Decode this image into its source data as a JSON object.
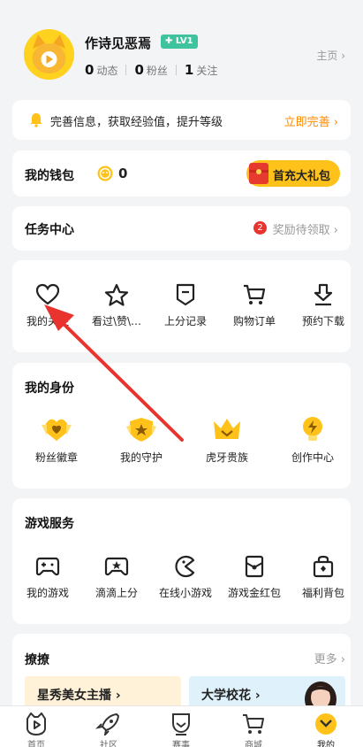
{
  "profile": {
    "username": "作诗见恶焉",
    "level": "✚ LV1",
    "dynamics_count": "0",
    "dynamics_label": "动态",
    "fans_count": "0",
    "fans_label": "粉丝",
    "follow_count": "1",
    "follow_label": "关注",
    "homepage_label": "主页 ›"
  },
  "notice": {
    "text": "完善信息，获取经验值，提升等级",
    "action": "立即完善 ›"
  },
  "wallet": {
    "title": "我的钱包",
    "balance": "0",
    "promo": "首充大礼包"
  },
  "tasks": {
    "title": "任务中心",
    "badge": "2",
    "reward_label": "奖励待领取 ›"
  },
  "quick": {
    "items": [
      {
        "label": "我的关注",
        "icon": "heart-icon"
      },
      {
        "label": "看过\\赞\\…",
        "icon": "star-icon"
      },
      {
        "label": "上分记录",
        "icon": "record-icon"
      },
      {
        "label": "购物订单",
        "icon": "cart-icon"
      },
      {
        "label": "预约下载",
        "icon": "download-icon"
      }
    ]
  },
  "identity": {
    "title": "我的身份",
    "items": [
      {
        "label": "粉丝徽章",
        "icon": "fan-badge-icon"
      },
      {
        "label": "我的守护",
        "icon": "guard-icon"
      },
      {
        "label": "虎牙贵族",
        "icon": "crown-icon"
      },
      {
        "label": "创作中心",
        "icon": "creator-icon"
      }
    ]
  },
  "games": {
    "title": "游戏服务",
    "items": [
      {
        "label": "我的游戏",
        "icon": "gamepad-icon"
      },
      {
        "label": "滴滴上分",
        "icon": "gamepad-star-icon"
      },
      {
        "label": "在线小游戏",
        "icon": "pacman-icon"
      },
      {
        "label": "游戏金红包",
        "icon": "red-packet-icon"
      },
      {
        "label": "福利背包",
        "icon": "bag-icon"
      }
    ]
  },
  "liaoliao": {
    "title": "撩撩",
    "more": "更多 ›",
    "card1": "星秀美女主播 ›",
    "card2": "大学校花 ›"
  },
  "tabbar": {
    "tabs": [
      {
        "label": "首页",
        "icon": "home-icon"
      },
      {
        "label": "社区",
        "icon": "rocket-icon"
      },
      {
        "label": "赛事",
        "icon": "trophy-icon"
      },
      {
        "label": "商城",
        "icon": "cart-icon"
      },
      {
        "label": "我的",
        "icon": "profile-icon"
      }
    ],
    "active_index": 4
  },
  "colors": {
    "accent": "#ffc21a",
    "orange": "#ff8a00",
    "lv_green": "#3fc39e",
    "arrow_red": "#e8332f"
  }
}
